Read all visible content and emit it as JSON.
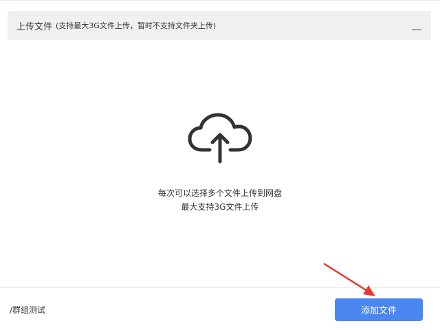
{
  "header": {
    "title": "上传文件",
    "note": "(支持最大3G文件上传，暂时不支持文件夹上传)"
  },
  "drop_area": {
    "icon": "cloud-upload-icon",
    "hint_line1": "每次可以选择多个文件上传到网盘",
    "hint_line2": "最大支持3G文件上传"
  },
  "footer": {
    "path": "/群组测试",
    "add_button_label": "添加文件"
  },
  "colors": {
    "accent": "#4a87f0",
    "header_bg": "#f0f0f0",
    "annotation_arrow": "#e53935",
    "icon": "#333333"
  }
}
